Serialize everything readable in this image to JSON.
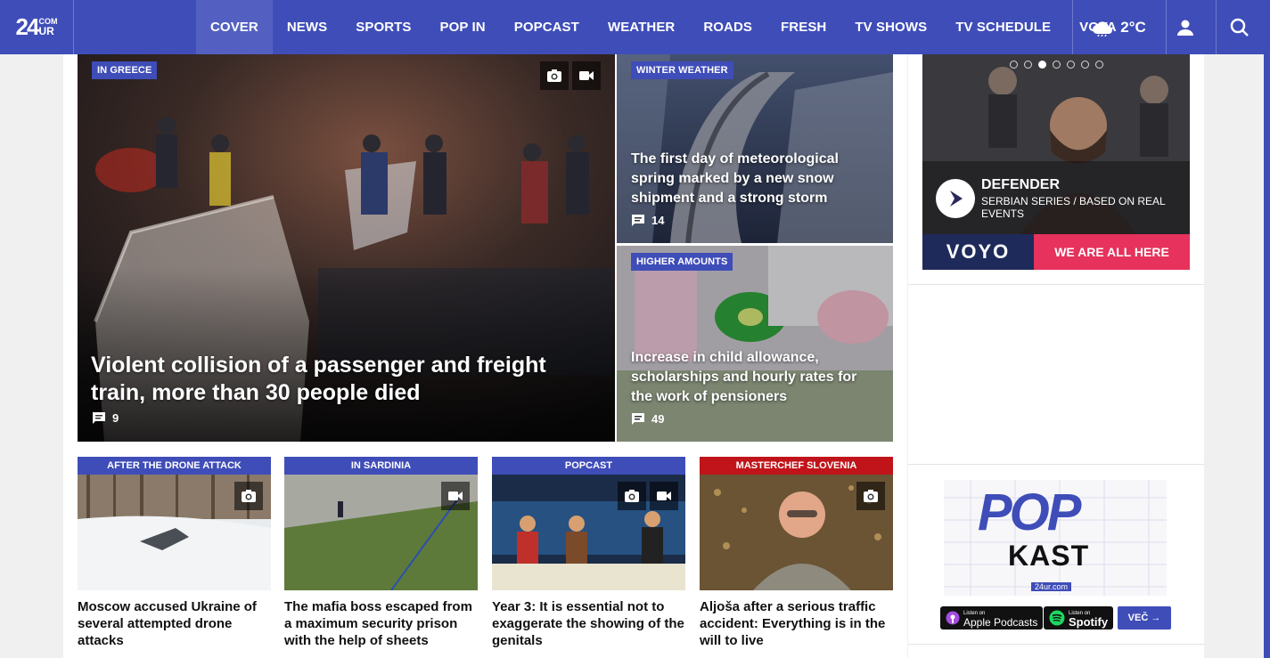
{
  "header": {
    "logo": {
      "main": "24",
      "sup": "COM",
      "sub": "UR"
    },
    "nav": [
      "COVER",
      "NEWS",
      "SPORTS",
      "POP IN",
      "POPCAST",
      "WEATHER",
      "ROADS",
      "FRESH",
      "TV SHOWS",
      "TV SCHEDULE",
      "VOYA"
    ],
    "active_nav": "COVER",
    "weather_temp": "2°C"
  },
  "hero": {
    "tag": "IN GREECE",
    "title": "Violent collision of a passenger and freight train, more than 30 people died",
    "comments": "9"
  },
  "side_stories": [
    {
      "tag": "WINTER WEATHER",
      "title": "The first day of meteorological spring marked by a new snow shipment and a strong storm",
      "comments": "14"
    },
    {
      "tag": "HIGHER AMOUNTS",
      "title": "Increase in child allowance, scholarships and hourly rates for the work of pensioners",
      "comments": "49"
    }
  ],
  "cards": [
    {
      "tag": "AFTER THE DRONE ATTACK",
      "title": "Moscow accused Ukraine of several attempted drone attacks",
      "tag_color": "#3f4db8"
    },
    {
      "tag": "IN SARDINIA",
      "title": "The mafia boss escaped from a maximum security prison with the help of sheets",
      "tag_color": "#3f4db8"
    },
    {
      "tag": "POPCAST",
      "title": "Year 3: It is essential not to exaggerate the showing of the genitals",
      "tag_color": "#3f4db8"
    },
    {
      "tag": "MASTERCHEF SLOVENIA",
      "title": "Aljoša after a serious traffic accident: Everything is in the will to live",
      "tag_color": "#c0141a"
    }
  ],
  "voyo": {
    "show_title": "DEFENDER",
    "show_sub": "SERBIAN SERIES / BASED ON REAL EVENTS",
    "logo": "VOYO",
    "cta": "WE ARE ALL HERE"
  },
  "popkast": {
    "logo_top": "POP",
    "logo_bottom": "KAST",
    "site": "24ur.com",
    "apple_small": "Listen on",
    "apple": "Apple Podcasts",
    "spotify_small": "Listen on",
    "spotify": "Spotify",
    "more": "VEČ →"
  },
  "colors": {
    "brand": "#3f4db8",
    "voyo_pink": "#e6325c",
    "masterchef_red": "#c0141a"
  }
}
